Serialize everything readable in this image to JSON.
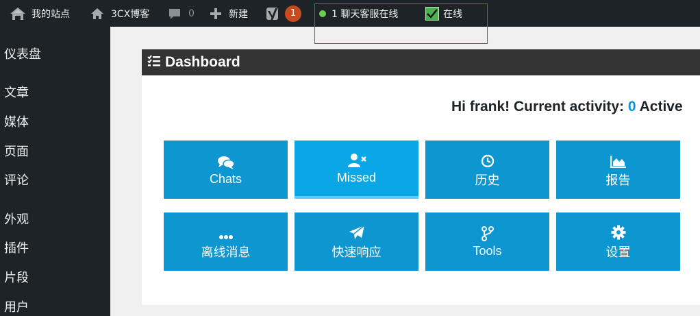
{
  "adminbar": {
    "site_label": "我的站点",
    "blog_label": "3CX博客",
    "comments_count": "0",
    "new_label": "新建",
    "notification_count": "1",
    "chat_status": "1 聊天客服在线",
    "online_label": "在线"
  },
  "sidebar": {
    "items": [
      {
        "label": "仪表盘"
      },
      {
        "label": "文章"
      },
      {
        "label": "媒体"
      },
      {
        "label": "页面"
      },
      {
        "label": "评论"
      },
      {
        "label": "外观"
      },
      {
        "label": "插件"
      },
      {
        "label": "片段"
      },
      {
        "label": "用户"
      }
    ]
  },
  "dashboard": {
    "title": "Dashboard",
    "greeting_prefix": "Hi frank! Current activity: ",
    "active_count": "0",
    "greeting_suffix": " Active"
  },
  "tiles": [
    {
      "label": "Chats",
      "icon": "chat-bubbles-icon"
    },
    {
      "label": "Missed",
      "icon": "user-times-icon"
    },
    {
      "label": "历史",
      "icon": "clock-icon"
    },
    {
      "label": "报告",
      "icon": "area-chart-icon"
    },
    {
      "label": "离线消息",
      "icon": "ellipsis-icon"
    },
    {
      "label": "快速响应",
      "icon": "paper-plane-icon"
    },
    {
      "label": "Tools",
      "icon": "code-fork-icon"
    },
    {
      "label": "设置",
      "icon": "gear-icon"
    }
  ],
  "colors": {
    "adminbar_bg": "#1d2327",
    "tile_bg": "#0d96d0",
    "tile_active_bg": "#0aa6e6",
    "accent_count": "#0a95d6",
    "notification_badge": "#ca4a1f",
    "online_dot": "#6ad04b"
  }
}
